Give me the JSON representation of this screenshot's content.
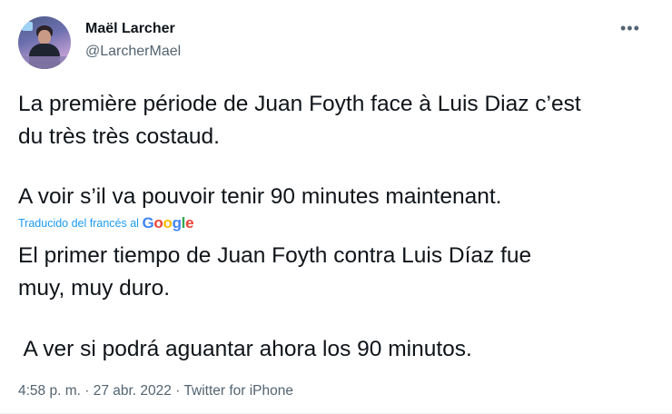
{
  "tweet": {
    "author": {
      "name": "Maël Larcher",
      "handle": "@LarcherMael"
    },
    "more_glyph": "•••",
    "original_lines": [
      "La première période de Juan Foyth face à Luis Diaz c’est",
      "du très très costaud.",
      "A voir s’il va pouvoir tenir 90 minutes maintenant."
    ],
    "translation_note": "Traducido del francés al",
    "translation_brand": {
      "letters": [
        "G",
        "o",
        "o",
        "g",
        "l",
        "e"
      ],
      "colors": [
        "#4285F4",
        "#EA4335",
        "#FBBC05",
        "#4285F4",
        "#34A853",
        "#EA4335"
      ]
    },
    "translated_lines": [
      "El primer tiempo de Juan Foyth contra Luis Díaz fue",
      "muy, muy duro.",
      " A ver si podrá aguantar ahora los 90 minutos."
    ],
    "timestamp": "4:58 p. m. · 27 abr. 2022 · Twitter for iPhone"
  }
}
